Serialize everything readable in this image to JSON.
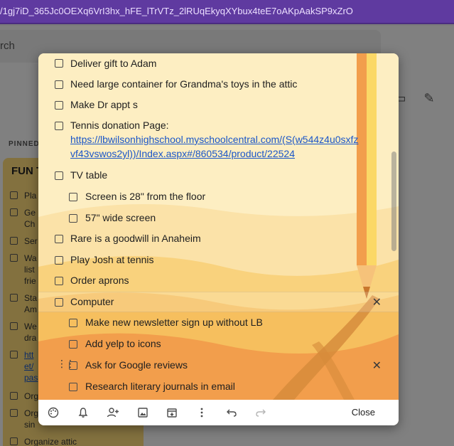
{
  "browser": {
    "url": "/1gj7iD_365Jc0OEXq6VrI3hx_hFE_lTrVTz_2lRUqEkyqXYbux4teE7oAKpAakSP9xZrO"
  },
  "background": {
    "search_placeholder": "rch",
    "pinned_label": "PINNED",
    "card_title": "FUN T",
    "card_items": [
      "Pla",
      "Ge",
      "Ch",
      "Ser",
      "Wa",
      "list",
      "frie",
      "Sta",
      "Am",
      "We",
      "dra",
      "htt",
      "et/",
      "pas",
      "Org",
      "Org",
      "sin",
      "Organize attic"
    ]
  },
  "note": {
    "items": [
      {
        "text": "Deliver gift to Adam",
        "indent": false
      },
      {
        "text": "Need large container for Grandma's toys in the attic",
        "indent": false
      },
      {
        "text": "Make Dr appt s",
        "indent": false
      },
      {
        "text": "Tennis donation Page:",
        "indent": false
      },
      {
        "text": "https://lbwilsonhighschool.myschoolcentral.com/(S(w544z4u0sxfz",
        "indent": false,
        "link": true
      },
      {
        "text": "vf43vswos2yl))/Index.aspx#/860534/product/22524",
        "indent": false,
        "link": true
      },
      {
        "text": "TV table",
        "indent": false
      },
      {
        "text": "Screen is 28\" from the floor",
        "indent": true
      },
      {
        "text": "57\" wide screen",
        "indent": true
      },
      {
        "text": "Rare is a goodwill in Anaheim",
        "indent": false
      },
      {
        "text": "Play Josh at tennis",
        "indent": false
      },
      {
        "text": "Order aprons",
        "indent": false
      },
      {
        "text": "Computer",
        "indent": false
      },
      {
        "text": "Make new newsletter sign up without LB",
        "indent": true
      },
      {
        "text": "Add yelp to icons",
        "indent": true
      },
      {
        "text": "Ask for Google reviews",
        "indent": true
      },
      {
        "text": "Research literary journals in email",
        "indent": true
      }
    ],
    "close_label": "Close",
    "colors": {
      "note_bg": "#fdeec2",
      "accent": "#f29e4c"
    }
  }
}
